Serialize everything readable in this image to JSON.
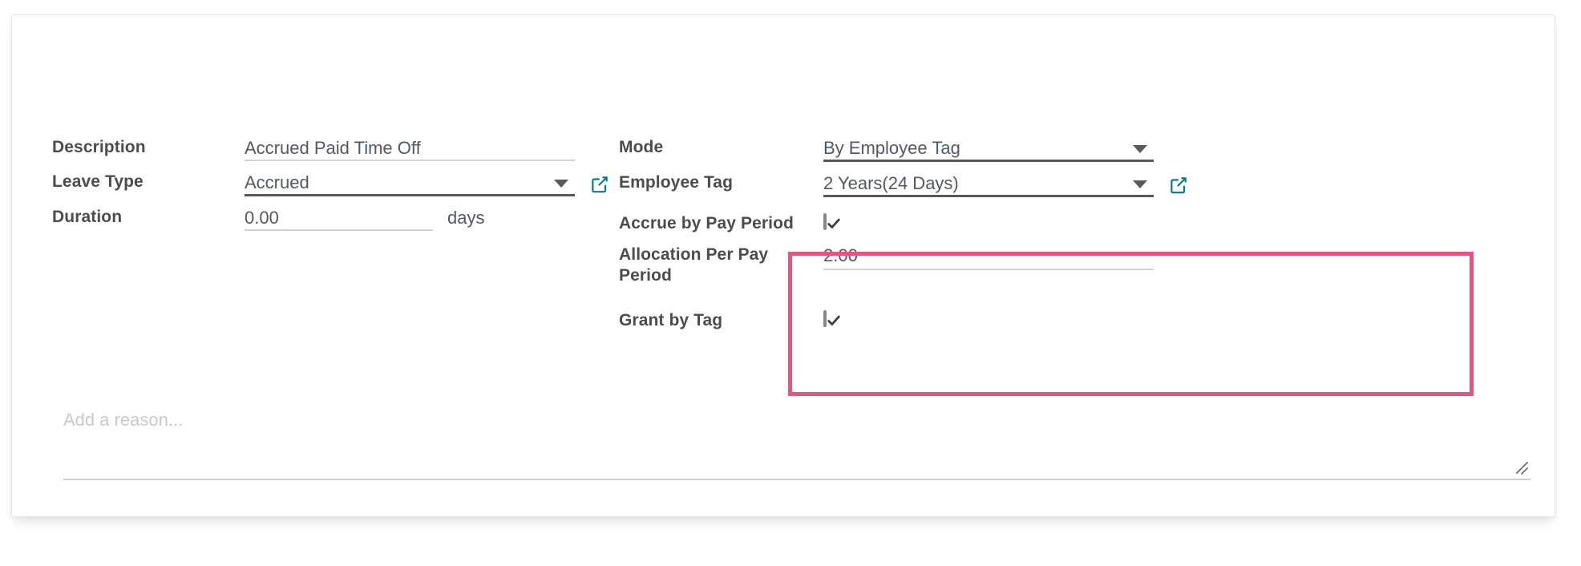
{
  "form": {
    "left_column": [
      {
        "label": "Description",
        "type": "text",
        "value": "Accrued Paid Time Off",
        "underline": "light",
        "has_caret": false,
        "has_external_link": false,
        "suffix": ""
      },
      {
        "label": "Leave Type",
        "type": "select",
        "value": "Accrued",
        "underline": "dark",
        "has_caret": true,
        "has_external_link": true,
        "suffix": ""
      },
      {
        "label": "Duration",
        "type": "number",
        "value": "0.00",
        "underline": "light",
        "has_caret": false,
        "has_external_link": false,
        "suffix": "days"
      }
    ],
    "right_column": [
      {
        "label": "Mode",
        "type": "select",
        "value": "By Employee Tag",
        "underline": "dark",
        "has_caret": true,
        "has_external_link": false
      },
      {
        "label": "Employee Tag",
        "type": "select",
        "value": "2 Years(24 Days)",
        "underline": "dark",
        "has_caret": true,
        "has_external_link": true
      },
      {
        "label": "Accrue by Pay Period",
        "type": "checkbox",
        "checked": true
      },
      {
        "label": "Allocation Per Pay Period",
        "type": "number",
        "value": "2.00",
        "underline": "light"
      },
      {
        "label": "Grant by Tag",
        "type": "checkbox",
        "checked": true
      }
    ],
    "reason": {
      "value": "",
      "placeholder": "Add a reason..."
    }
  },
  "highlight": {
    "color": "#e8547e",
    "label": "accrual-settings-highlight"
  },
  "colors": {
    "accent_link": "#017e84",
    "label_text": "#4c4c4c",
    "value_text": "#54595e",
    "underline_light": "#d2d2d2",
    "underline_dark": "#55595c",
    "highlight": "#e8547e"
  },
  "icons": {
    "external_link": "external-link-icon",
    "dropdown_caret": "chevron-down-icon",
    "checkmark": "check-icon",
    "resize": "resize-grip-icon"
  }
}
